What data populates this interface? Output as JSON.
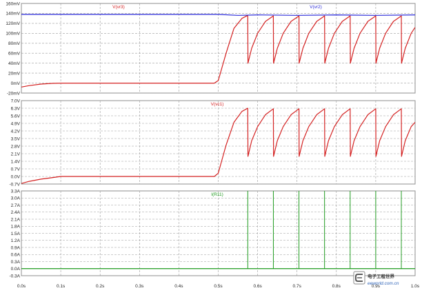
{
  "panes": [
    {
      "traces": [
        {
          "name": "V(vr3)",
          "color": "#d42020"
        },
        {
          "name": "V(vr2)",
          "color": "#2a2ad8"
        }
      ],
      "y_ticks": [
        "-20mV",
        "0mV",
        "20mV",
        "40mV",
        "60mV",
        "80mV",
        "100mV",
        "120mV",
        "140mV",
        "160mV"
      ]
    },
    {
      "traces": [
        {
          "name": "V(vc1)",
          "color": "#d42020"
        }
      ],
      "y_ticks": [
        "-0.7V",
        "0.0V",
        "0.7V",
        "1.4V",
        "2.1V",
        "2.8V",
        "3.5V",
        "4.2V",
        "4.9V",
        "5.6V",
        "6.3V",
        "7.0V"
      ]
    },
    {
      "traces": [
        {
          "name": "I(R11)",
          "color": "#1d9a1d"
        }
      ],
      "y_ticks": [
        "-0.3A",
        "0.0A",
        "0.3A",
        "0.6A",
        "0.9A",
        "1.2A",
        "1.5A",
        "1.8A",
        "2.1A",
        "2.4A",
        "2.7A",
        "3.0A",
        "3.3A"
      ]
    }
  ],
  "x_ticks": [
    "0.0s",
    "0.1s",
    "0.2s",
    "0.3s",
    "0.4s",
    "0.5s",
    "0.6s",
    "0.7s",
    "0.8s",
    "0.9s",
    "1.0s"
  ],
  "watermark": {
    "line1": "电子工程世界",
    "line2": "eeworld.com.cn"
  },
  "chart_data": [
    {
      "type": "line",
      "xlabel": "",
      "ylabel": "",
      "xlim": [
        0,
        1.0
      ],
      "ylim": [
        -20,
        160
      ],
      "y_unit": "mV",
      "grid": true,
      "series": [
        {
          "name": "V(vr3)",
          "color": "#d42020",
          "x": [
            0.0,
            0.02,
            0.05,
            0.08,
            0.1,
            0.15,
            0.3,
            0.49,
            0.5,
            0.52,
            0.54,
            0.56,
            0.575,
            0.5755,
            0.585,
            0.6,
            0.62,
            0.64,
            0.6405,
            0.65,
            0.665,
            0.685,
            0.705,
            0.7055,
            0.715,
            0.73,
            0.75,
            0.77,
            0.7705,
            0.78,
            0.795,
            0.815,
            0.835,
            0.8355,
            0.845,
            0.86,
            0.88,
            0.9,
            0.9005,
            0.91,
            0.925,
            0.945,
            0.965,
            0.9655,
            0.975,
            0.99,
            1.0
          ],
          "y": [
            -8,
            -5,
            -2,
            -0.5,
            0,
            0,
            0,
            0,
            5,
            60,
            110,
            130,
            136,
            40,
            70,
            100,
            124,
            135,
            40,
            70,
            100,
            124,
            135,
            40,
            70,
            100,
            124,
            135,
            40,
            70,
            100,
            124,
            135,
            40,
            70,
            100,
            124,
            135,
            40,
            70,
            100,
            124,
            135,
            40,
            70,
            100,
            112
          ]
        },
        {
          "name": "V(vr2)",
          "color": "#2a2ad8",
          "x": [
            0.0,
            0.5,
            0.55,
            0.6,
            0.7,
            0.8,
            0.9,
            1.0
          ],
          "y": [
            138,
            138,
            136,
            137,
            136,
            137,
            136,
            137
          ]
        }
      ]
    },
    {
      "type": "line",
      "xlabel": "",
      "ylabel": "",
      "xlim": [
        0,
        1.0
      ],
      "ylim": [
        -0.7,
        7.0
      ],
      "y_unit": "V",
      "grid": true,
      "series": [
        {
          "name": "V(vc1)",
          "color": "#d42020",
          "x": [
            0.0,
            0.02,
            0.05,
            0.08,
            0.1,
            0.15,
            0.3,
            0.49,
            0.5,
            0.52,
            0.54,
            0.56,
            0.575,
            0.5755,
            0.585,
            0.6,
            0.62,
            0.64,
            0.6405,
            0.65,
            0.665,
            0.685,
            0.705,
            0.7055,
            0.715,
            0.73,
            0.75,
            0.77,
            0.7705,
            0.78,
            0.795,
            0.815,
            0.835,
            0.8355,
            0.845,
            0.86,
            0.88,
            0.9,
            0.9005,
            0.91,
            0.925,
            0.945,
            0.965,
            0.9655,
            0.975,
            0.99,
            1.0
          ],
          "y": [
            -0.65,
            -0.45,
            -0.25,
            -0.1,
            0,
            0,
            0,
            0,
            0.3,
            2.9,
            5.0,
            6.0,
            6.3,
            1.85,
            3.3,
            4.6,
            5.7,
            6.25,
            1.85,
            3.3,
            4.6,
            5.7,
            6.25,
            1.85,
            3.3,
            4.6,
            5.7,
            6.25,
            1.85,
            3.3,
            4.6,
            5.7,
            6.25,
            1.85,
            3.3,
            4.6,
            5.7,
            6.25,
            1.85,
            3.3,
            4.6,
            5.7,
            6.25,
            1.85,
            3.3,
            4.6,
            5.0
          ]
        }
      ]
    },
    {
      "type": "line",
      "xlabel": "",
      "ylabel": "",
      "xlim": [
        0,
        1.0
      ],
      "ylim": [
        -0.3,
        3.3
      ],
      "y_unit": "A",
      "grid": true,
      "series": [
        {
          "name": "I(R11)",
          "color": "#1d9a1d",
          "baseline": 0,
          "spike_x": [
            0.575,
            0.64,
            0.705,
            0.77,
            0.835,
            0.9,
            0.965
          ],
          "spike_y": [
            3.3,
            3.3,
            3.3,
            3.3,
            3.3,
            3.3,
            3.3
          ]
        }
      ]
    }
  ]
}
